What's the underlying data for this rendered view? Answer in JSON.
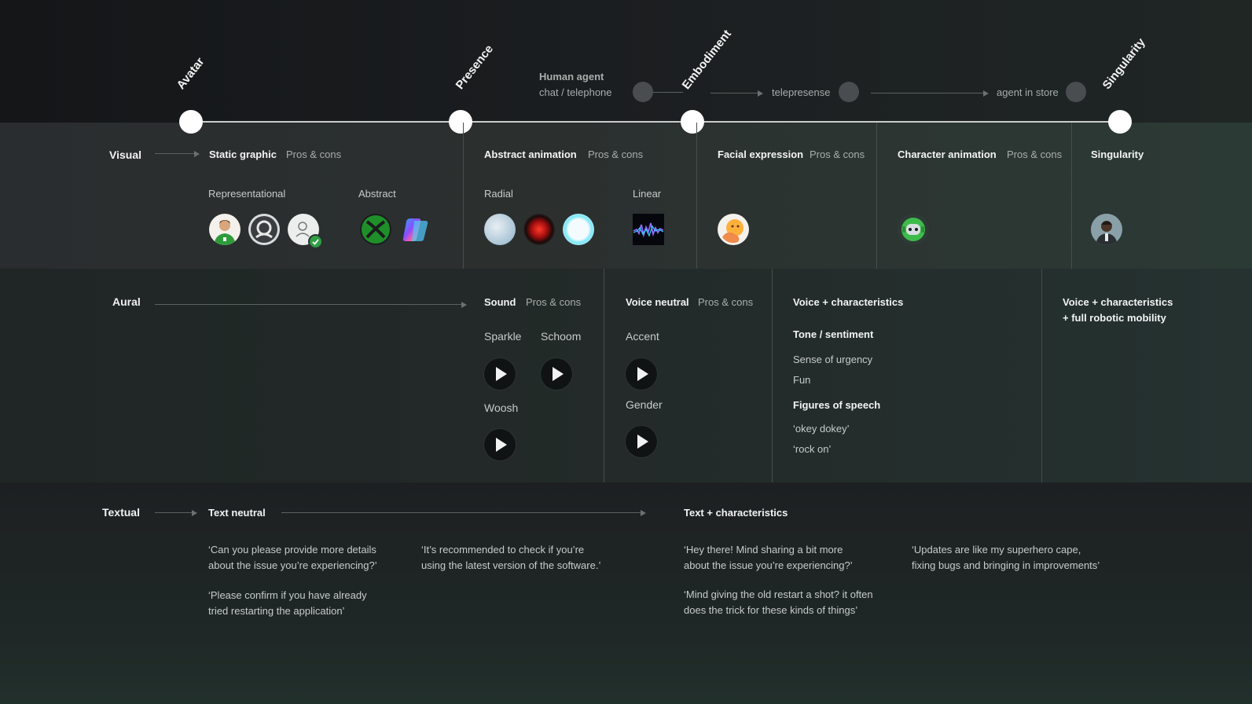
{
  "milestones": [
    "Avatar",
    "Presence",
    "Embodiment",
    "Singularity"
  ],
  "timeline": {
    "human_agent_title": "Human agent",
    "human_agent_sub": "chat / telephone",
    "telepresence": "telepresense",
    "agent_in_store": "agent in store"
  },
  "visual": {
    "label": "Visual",
    "static_graphic": "Static graphic",
    "abstract_animation": "Abstract animation",
    "facial_expression": "Facial expression",
    "character_animation": "Character animation",
    "singularity": "Singularity",
    "pros_cons": "Pros & cons",
    "representational": "Representational",
    "abstract": "Abstract",
    "radial": "Radial",
    "linear": "Linear"
  },
  "aural": {
    "label": "Aural",
    "sound": "Sound",
    "pros_cons": "Pros & cons",
    "sparkle": "Sparkle",
    "schoom": "Schoom",
    "woosh": "Woosh",
    "voice_neutral": "Voice neutral",
    "accent": "Accent",
    "gender": "Gender",
    "voice_characteristics": "Voice + characteristics",
    "tone_sentiment": "Tone / sentiment",
    "sense_of_urgency": "Sense of urgency",
    "fun": "Fun",
    "figures_of_speech": "Figures of speech",
    "okey_dokey": "‘okey dokey’",
    "rock_on": "‘rock on’",
    "robotic_line1": "Voice + characteristics",
    "robotic_line2": "+ full robotic mobility"
  },
  "textual": {
    "label": "Textual",
    "text_neutral": "Text neutral",
    "text_characteristics": "Text + characteristics",
    "q1_line1": "‘Can you please provide more details",
    "q1_line2": "about the issue you’re experiencing?’",
    "q2_line1": "‘Please confirm if you have already",
    "q2_line2": "tried restarting the application’",
    "q3_line1": "‘It’s recommended to check if you’re",
    "q3_line2": "using the latest version of the software.’",
    "q4_line1": "‘Hey there! Mind sharing a bit more",
    "q4_line2": "about the issue you’re experiencing?’",
    "q5_line1": "‘Mind giving the old restart a shot? it often",
    "q5_line2": "does the trick for these kinds of things’",
    "q6_line1": "‘Updates are like my superhero cape,",
    "q6_line2": "fixing bugs and bringing in improvements’"
  },
  "colors": {
    "background": "#1a1d1e",
    "accent_green": "#3aa33a",
    "text_primary": "#f2f4f3",
    "text_secondary": "#a9aeac"
  }
}
